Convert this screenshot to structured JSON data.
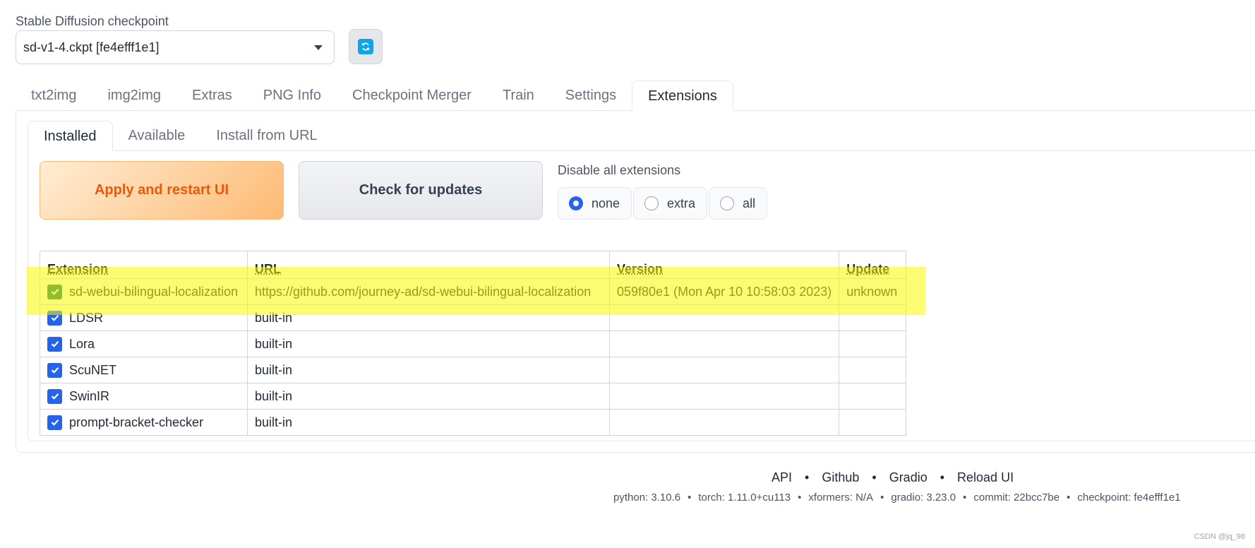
{
  "checkpoint": {
    "label": "Stable Diffusion checkpoint",
    "selected": "sd-v1-4.ckpt [fe4efff1e1]"
  },
  "main_tabs": [
    {
      "label": "txt2img"
    },
    {
      "label": "img2img"
    },
    {
      "label": "Extras"
    },
    {
      "label": "PNG Info"
    },
    {
      "label": "Checkpoint Merger"
    },
    {
      "label": "Train"
    },
    {
      "label": "Settings"
    },
    {
      "label": "Extensions",
      "active": true
    }
  ],
  "sub_tabs": [
    {
      "label": "Installed",
      "active": true
    },
    {
      "label": "Available"
    },
    {
      "label": "Install from URL"
    }
  ],
  "buttons": {
    "apply_label": "Apply and restart UI",
    "check_label": "Check for updates"
  },
  "disable_all": {
    "label": "Disable all extensions",
    "options": [
      "none",
      "extra",
      "all"
    ],
    "selected": "none"
  },
  "table": {
    "headers": [
      "Extension",
      "URL",
      "Version",
      "Update"
    ],
    "rows": [
      {
        "name": "sd-webui-bilingual-localization",
        "url": "https://github.com/journey-ad/sd-webui-bilingual-localization",
        "version": "059f80e1 (Mon Apr 10 10:58:03 2023)",
        "update": "unknown",
        "checked": true
      },
      {
        "name": "LDSR",
        "url": "built-in",
        "version": "",
        "update": "",
        "checked": true
      },
      {
        "name": "Lora",
        "url": "built-in",
        "version": "",
        "update": "",
        "checked": true
      },
      {
        "name": "ScuNET",
        "url": "built-in",
        "version": "",
        "update": "",
        "checked": true
      },
      {
        "name": "SwinIR",
        "url": "built-in",
        "version": "",
        "update": "",
        "checked": true
      },
      {
        "name": "prompt-bracket-checker",
        "url": "built-in",
        "version": "",
        "update": "",
        "checked": true
      }
    ]
  },
  "footer": {
    "links": [
      "API",
      "Github",
      "Gradio",
      "Reload UI"
    ],
    "separator": "•",
    "info": [
      "python: 3.10.6",
      "torch: 1.11.0+cu113",
      "xformers: N/A",
      "gradio: 3.23.0",
      "commit: 22bcc7be",
      "checkpoint: fe4efff1e1"
    ]
  },
  "watermark": "CSDN @jq_98",
  "colors": {
    "accent": "#2563eb",
    "apply_text": "#ea580c",
    "highlight": "#fafa00"
  }
}
